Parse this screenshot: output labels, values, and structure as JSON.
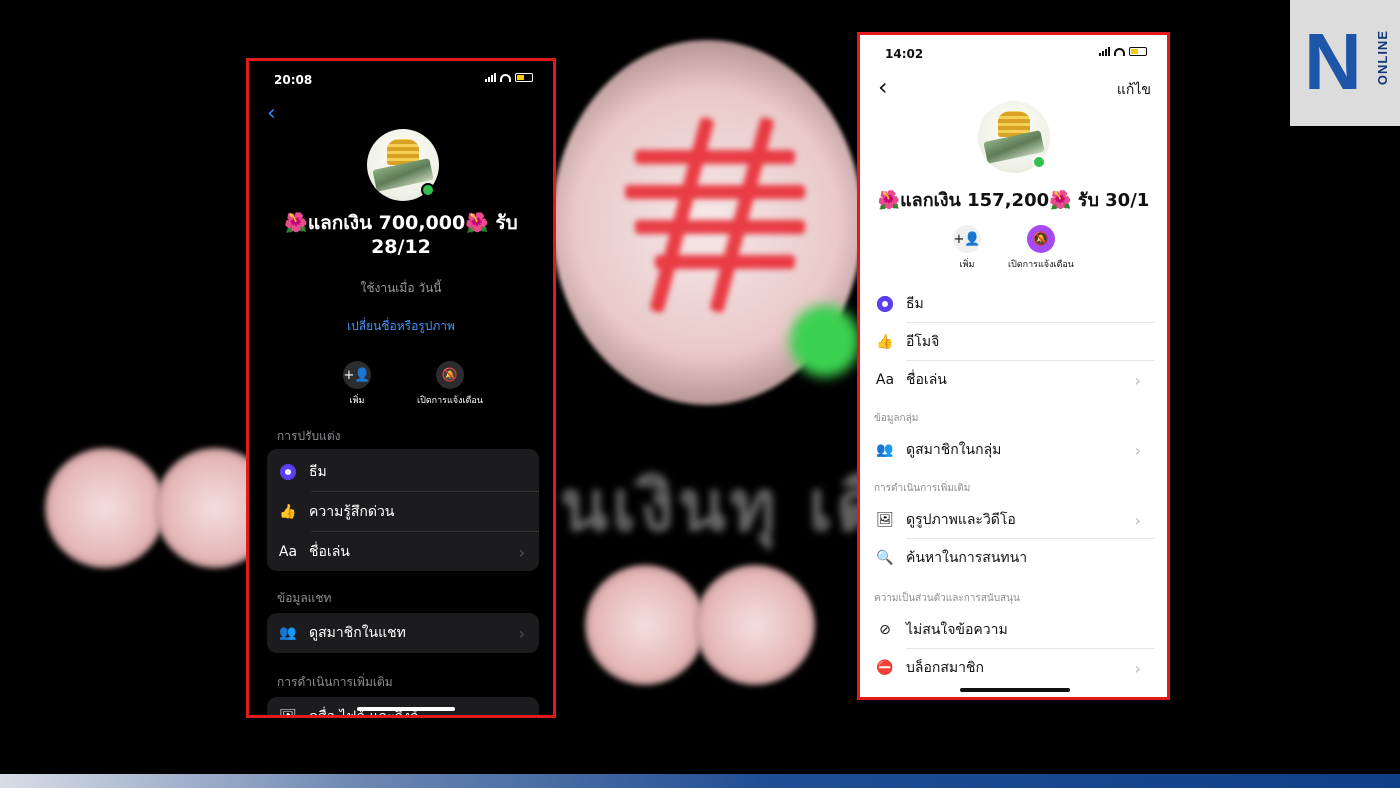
{
  "background": {
    "blurred_text": "นเงินทุ  เดียว"
  },
  "logo": {
    "letter": "N",
    "word": "ONLINE"
  },
  "left_phone": {
    "status_time": "20:08",
    "back_icon": "chevron-left-icon",
    "group_name_line1": "🌺แลกเงิน 700,000🌺 รับ",
    "group_name_line2": "28/12",
    "last_active": "ใช้งานเมื่อ วันนี้",
    "change_link": "เปลี่ยนชื่อหรือรูปภาพ",
    "actions": [
      {
        "label": "เพิ่ม",
        "icon": "add-person-icon"
      },
      {
        "label": "เปิดการแจ้งเตือน",
        "icon": "bell-muted-icon"
      }
    ],
    "section_customize": "การปรับแต่ง",
    "customize_rows": [
      {
        "label": "ธีม",
        "icon": "theme-icon"
      },
      {
        "label": "ความรู้สึกด่วน",
        "icon": "thumbs-up-icon"
      },
      {
        "label": "ชื่อเล่น",
        "icon": "Aa"
      }
    ],
    "section_chat_info": "ข้อมูลแชท",
    "chat_info_rows": [
      {
        "label": "ดูสมาชิกในแชท",
        "icon": "people-icon"
      }
    ],
    "section_more_actions": "การดำเนินการเพิ่มเติม",
    "more_actions_rows": [
      {
        "label": "ดูสื่อ ไฟล์ และลิงก์",
        "icon": "image-icon"
      }
    ]
  },
  "right_phone": {
    "status_time": "14:02",
    "back_icon": "chevron-left-icon",
    "edit_label": "แก้ไข",
    "group_name": "🌺แลกเงิน 157,200🌺 รับ 30/1",
    "actions": [
      {
        "label": "เพิ่ม",
        "icon": "add-person-icon"
      },
      {
        "label": "เปิดการแจ้งเตือน",
        "icon": "bell-muted-icon"
      }
    ],
    "top_rows": [
      {
        "label": "ธีม",
        "icon": "theme-icon"
      },
      {
        "label": "อีโมจิ",
        "icon": "thumbs-up-icon"
      },
      {
        "label": "ชื่อเล่น",
        "icon": "Aa"
      }
    ],
    "section_group_info": "ข้อมูลกลุ่ม",
    "group_info_rows": [
      {
        "label": "ดูสมาชิกในกลุ่ม",
        "icon": "people-icon"
      }
    ],
    "section_more_actions": "การดำเนินการเพิ่มเติม",
    "more_actions_rows": [
      {
        "label": "ดูรูปภาพและวิดีโอ",
        "icon": "image-icon"
      },
      {
        "label": "ค้นหาในการสนทนา",
        "icon": "search-icon"
      }
    ],
    "section_privacy": "ความเป็นส่วนตัวและการสนับสนุน",
    "privacy_rows": [
      {
        "label": "ไม่สนใจข้อความ",
        "icon": "ignore-icon"
      },
      {
        "label": "บล็อกสมาชิก",
        "icon": "block-icon"
      }
    ]
  }
}
